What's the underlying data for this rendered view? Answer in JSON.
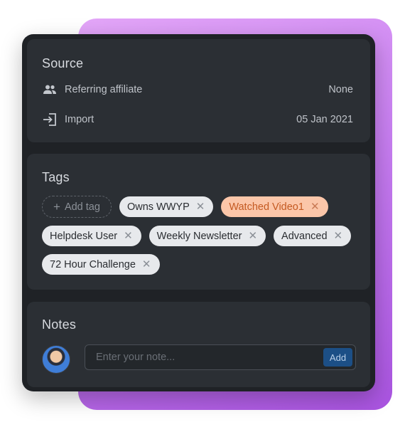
{
  "source": {
    "title": "Source",
    "rows": [
      {
        "icon": "people-icon",
        "label": "Referring affiliate",
        "value": "None"
      },
      {
        "icon": "import-icon",
        "label": "Import",
        "value": "05 Jan 2021"
      }
    ]
  },
  "tags": {
    "title": "Tags",
    "add_label": "Add tag",
    "items": [
      {
        "label": "Owns WWYP",
        "highlight": false
      },
      {
        "label": "Watched Video1",
        "highlight": true
      },
      {
        "label": "Helpdesk User",
        "highlight": false
      },
      {
        "label": "Weekly Newsletter",
        "highlight": false
      },
      {
        "label": "Advanced",
        "highlight": false
      },
      {
        "label": "72 Hour Challenge",
        "highlight": false
      }
    ],
    "remove_glyph": "✕"
  },
  "notes": {
    "title": "Notes",
    "placeholder": "Enter your note...",
    "value": "",
    "add_label": "Add"
  },
  "colors": {
    "backdrop_gradient": [
      "#e3a6f8",
      "#a954e0"
    ],
    "panel": "#1f2226",
    "section": "#2b2f34",
    "tag_highlight": "#fbc6a9",
    "add_button": "#1c4f86"
  }
}
